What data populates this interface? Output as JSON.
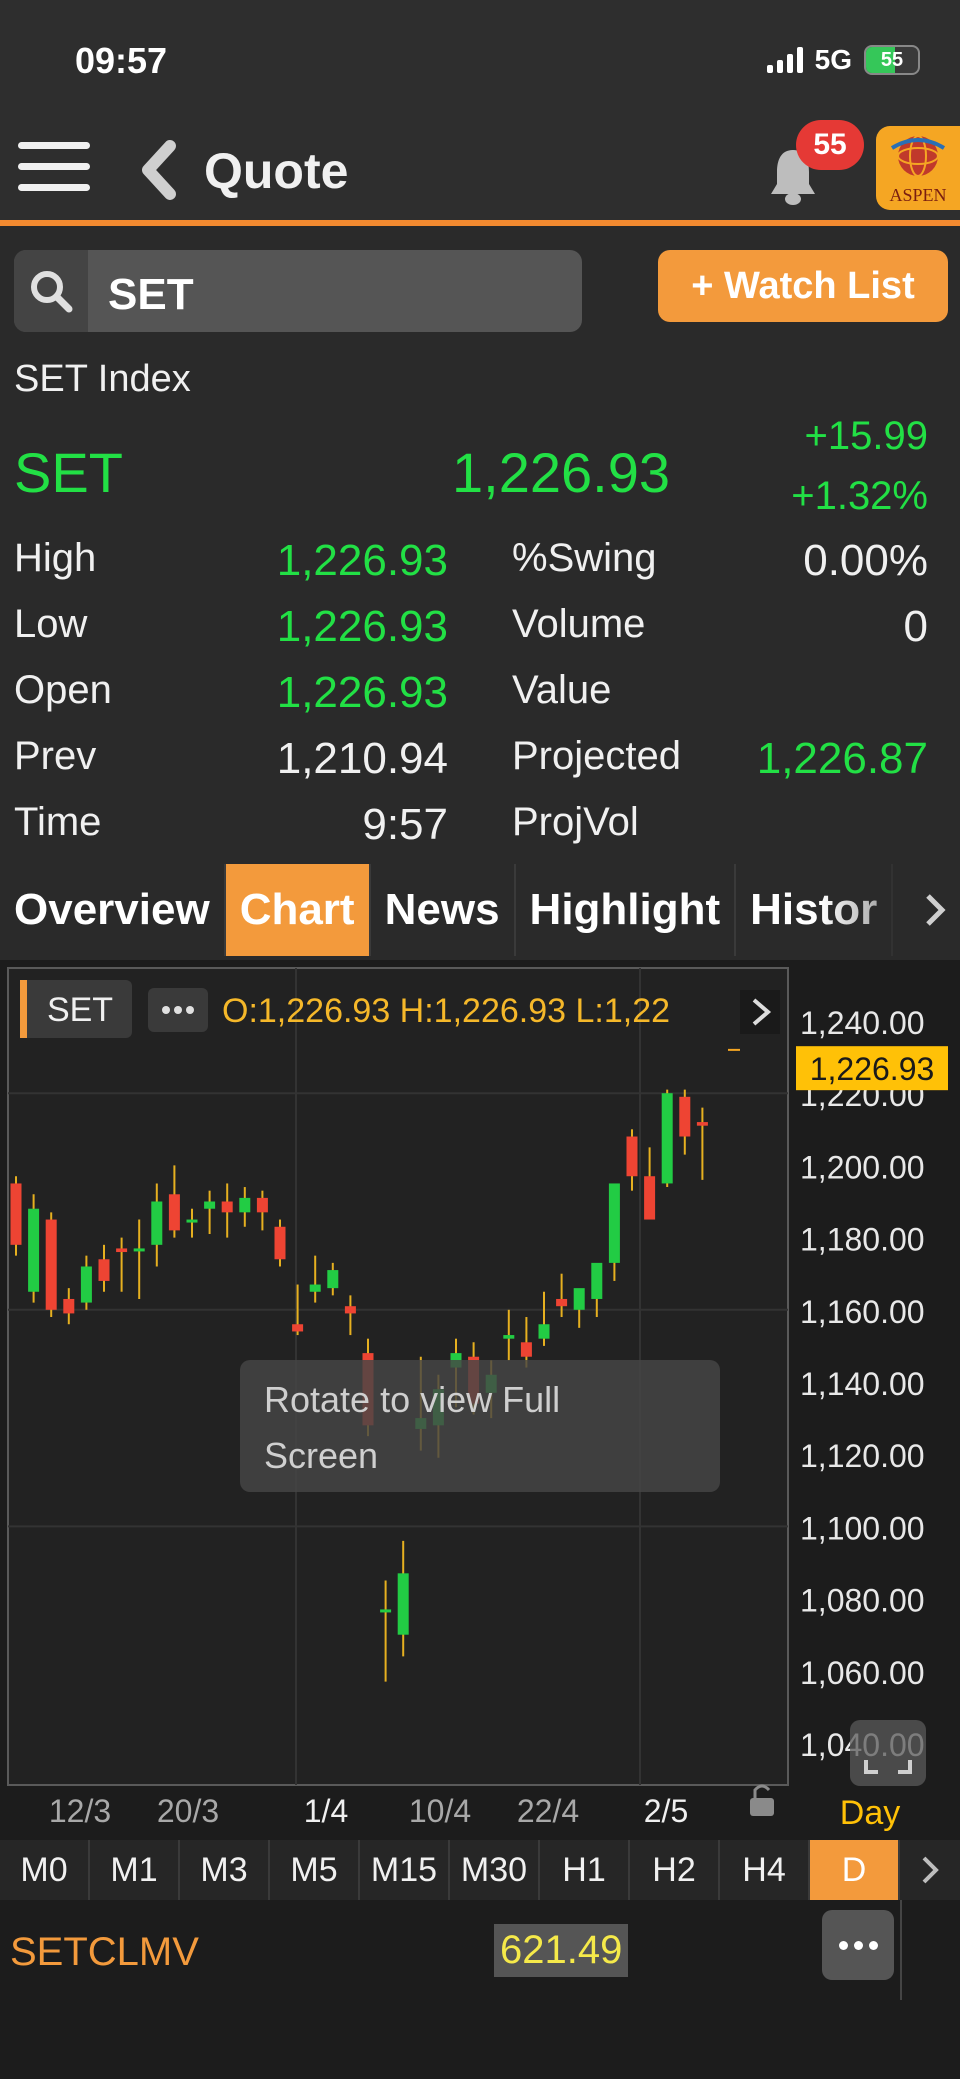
{
  "status": {
    "time": "09:57",
    "network": "5G",
    "battery": "55",
    "battery_level_pct": 55
  },
  "nav": {
    "title": "Quote",
    "notifications": "55",
    "brand": "ASPEN"
  },
  "search": {
    "value": "SET",
    "watch_label": "+ Watch List"
  },
  "quote": {
    "name": "SET Index",
    "symbol": "SET",
    "last": "1,226.93",
    "change": "+15.99",
    "change_pct": "+1.32%",
    "left_stats": [
      {
        "label": "High",
        "value": "1,226.93",
        "color": "#22e045"
      },
      {
        "label": "Low",
        "value": "1,226.93",
        "color": "#22e045"
      },
      {
        "label": "Open",
        "value": "1,226.93",
        "color": "#22e045"
      },
      {
        "label": "Prev",
        "value": "1,210.94",
        "color": "#f0f0f0"
      },
      {
        "label": "Time",
        "value": "9:57",
        "color": "#f0f0f0"
      }
    ],
    "right_stats": [
      {
        "label": "%Swing",
        "value": "0.00%",
        "color": "#f0f0f0"
      },
      {
        "label": "Volume",
        "value": "0",
        "color": "#f0f0f0"
      },
      {
        "label": "Value",
        "value": "",
        "color": "#f0f0f0"
      },
      {
        "label": "Projected",
        "value": "1,226.87",
        "color": "#22e045"
      },
      {
        "label": "ProjVol",
        "value": "",
        "color": "#f0f0f0"
      }
    ]
  },
  "tabs": [
    "Overview",
    "Chart",
    "News",
    "Highlight",
    "Histor"
  ],
  "active_tab": "Chart",
  "chart": {
    "symbol_label": "SET",
    "ohlc_text": "O:1,226.93  H:1,226.93  L:1,22",
    "price_tag": "1,226.93",
    "rotate_hint_line1": "Rotate to view Full",
    "rotate_hint_line2": "Screen",
    "period_label": "Day"
  },
  "chart_data": {
    "type": "candlestick",
    "y_ticks": [
      "1,240.00",
      "1,220.00",
      "1,200.00",
      "1,180.00",
      "1,160.00",
      "1,140.00",
      "1,120.00",
      "1,100.00",
      "1,080.00",
      "1,060.00",
      "1,040.00"
    ],
    "x_ticks": [
      "12/3",
      "20/3",
      "1/4",
      "10/4",
      "22/4",
      "2/5"
    ],
    "ylim": [
      1040,
      1240
    ],
    "current_price": 1226.93,
    "up_color": "#22cc44",
    "down_color": "#ee4433",
    "candles": [
      {
        "o": 1195,
        "h": 1197,
        "l": 1175,
        "c": 1178
      },
      {
        "o": 1165,
        "h": 1192,
        "l": 1162,
        "c": 1188
      },
      {
        "o": 1185,
        "h": 1187,
        "l": 1158,
        "c": 1160
      },
      {
        "o": 1163,
        "h": 1166,
        "l": 1156,
        "c": 1159
      },
      {
        "o": 1162,
        "h": 1175,
        "l": 1160,
        "c": 1172
      },
      {
        "o": 1174,
        "h": 1178,
        "l": 1165,
        "c": 1168
      },
      {
        "o": 1177,
        "h": 1180,
        "l": 1165,
        "c": 1176
      },
      {
        "o": 1177,
        "h": 1185,
        "l": 1163,
        "c": 1177
      },
      {
        "o": 1178,
        "h": 1195,
        "l": 1172,
        "c": 1190
      },
      {
        "o": 1192,
        "h": 1200,
        "l": 1180,
        "c": 1182
      },
      {
        "o": 1185,
        "h": 1188,
        "l": 1180,
        "c": 1185
      },
      {
        "o": 1188,
        "h": 1193,
        "l": 1181,
        "c": 1190
      },
      {
        "o": 1190,
        "h": 1195,
        "l": 1180,
        "c": 1187
      },
      {
        "o": 1187,
        "h": 1194,
        "l": 1183,
        "c": 1191
      },
      {
        "o": 1191,
        "h": 1193,
        "l": 1182,
        "c": 1187
      },
      {
        "o": 1183,
        "h": 1185,
        "l": 1172,
        "c": 1174
      },
      {
        "o": 1156,
        "h": 1167,
        "l": 1153,
        "c": 1154
      },
      {
        "o": 1165,
        "h": 1175,
        "l": 1162,
        "c": 1167
      },
      {
        "o": 1166,
        "h": 1173,
        "l": 1164,
        "c": 1171
      },
      {
        "o": 1161,
        "h": 1164,
        "l": 1153,
        "c": 1159
      },
      {
        "o": 1148,
        "h": 1152,
        "l": 1125,
        "c": 1128
      },
      {
        "o": 1077,
        "h": 1085,
        "l": 1057,
        "c": 1077
      },
      {
        "o": 1070,
        "h": 1096,
        "l": 1064,
        "c": 1087
      },
      {
        "o": 1127,
        "h": 1147,
        "l": 1121,
        "c": 1130
      },
      {
        "o": 1128,
        "h": 1142,
        "l": 1119,
        "c": 1138
      },
      {
        "o": 1144,
        "h": 1152,
        "l": 1133,
        "c": 1148
      },
      {
        "o": 1147,
        "h": 1151,
        "l": 1131,
        "c": 1134
      },
      {
        "o": 1137,
        "h": 1146,
        "l": 1130,
        "c": 1142
      },
      {
        "o": 1152,
        "h": 1160,
        "l": 1146,
        "c": 1153
      },
      {
        "o": 1151,
        "h": 1158,
        "l": 1144,
        "c": 1147
      },
      {
        "o": 1152,
        "h": 1165,
        "l": 1150,
        "c": 1156
      },
      {
        "o": 1163,
        "h": 1170,
        "l": 1158,
        "c": 1161
      },
      {
        "o": 1160,
        "h": 1165,
        "l": 1155,
        "c": 1166
      },
      {
        "o": 1163,
        "h": 1172,
        "l": 1158,
        "c": 1173
      },
      {
        "o": 1173,
        "h": 1178,
        "l": 1168,
        "c": 1195
      },
      {
        "o": 1208,
        "h": 1210,
        "l": 1193,
        "c": 1197
      },
      {
        "o": 1197,
        "h": 1205,
        "l": 1188,
        "c": 1185
      },
      {
        "o": 1195,
        "h": 1221,
        "l": 1194,
        "c": 1220
      },
      {
        "o": 1219,
        "h": 1221,
        "l": 1203,
        "c": 1208
      },
      {
        "o": 1212,
        "h": 1216,
        "l": 1196,
        "c": 1211
      }
    ]
  },
  "intervals": [
    "M0",
    "M1",
    "M3",
    "M5",
    "M15",
    "M30",
    "H1",
    "H2",
    "H4",
    "D"
  ],
  "active_interval": "D",
  "indicator": {
    "name": "SETCLMV",
    "value": "621.49"
  }
}
